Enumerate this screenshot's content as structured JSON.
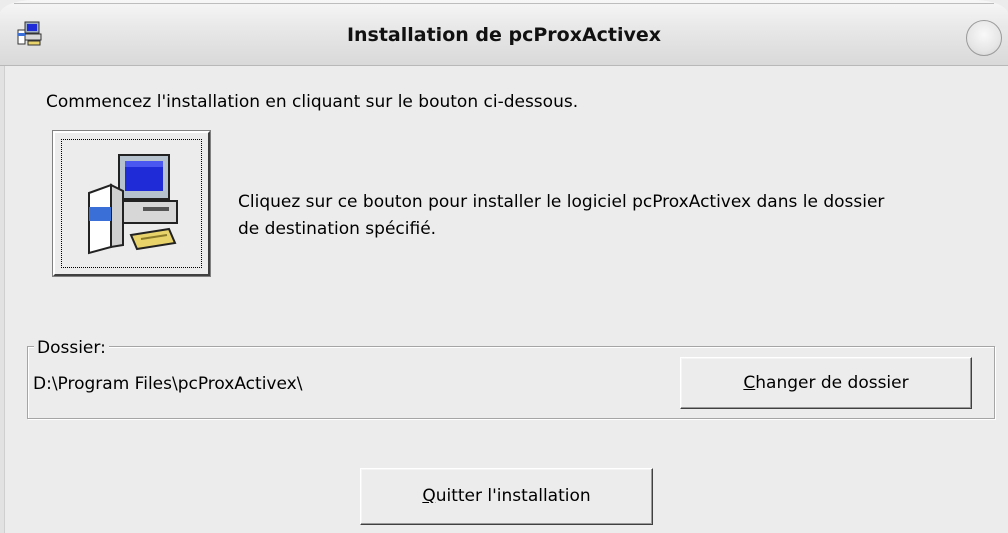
{
  "window": {
    "title": "Installation de pcProxActivex",
    "icon": "setup-computer-icon"
  },
  "main": {
    "instruction": "Commencez l'installation en cliquant sur le bouton ci-dessous.",
    "install_button_icon": "computer-setup-icon",
    "install_description_line1": "Cliquez sur ce bouton pour installer le logiciel pcProxActivex dans le dossier",
    "install_description_line2": "de destination spécifié."
  },
  "folder": {
    "label": "Dossier:",
    "path": "D:\\Program Files\\pcProxActivex\\",
    "change_button": {
      "mnemonic": "C",
      "rest": "hanger de dossier"
    }
  },
  "footer": {
    "quit_button": {
      "mnemonic": "Q",
      "rest": "uitter l'installation"
    }
  },
  "colors": {
    "window_bg": "#ececec",
    "monitor_screen": "#1f2bd6",
    "box_blue": "#3a6fd8"
  }
}
